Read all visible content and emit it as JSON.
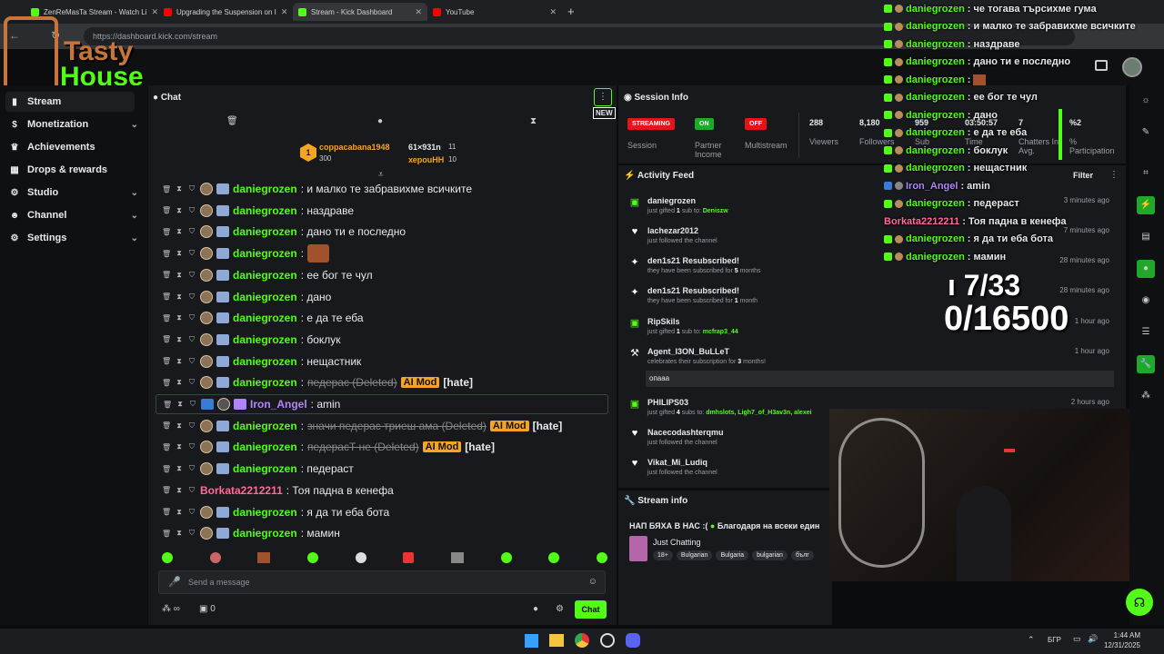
{
  "browser": {
    "tabs": [
      {
        "label": "ZenReMasTa Stream - Watch Li",
        "color": "#53fc18"
      },
      {
        "label": "Upgrading the Suspension on I",
        "color": "#ff0000"
      },
      {
        "label": "Stream - Kick Dashboard",
        "color": "#53fc18"
      },
      {
        "label": "YouTube",
        "color": "#ff0000"
      }
    ],
    "url": "https://dashboard.kick.com/stream"
  },
  "overlay_logo": {
    "line1": "Tasty",
    "line2": "House"
  },
  "nav": {
    "items": [
      {
        "label": "Stream"
      },
      {
        "label": "Monetization"
      },
      {
        "label": "Achievements"
      },
      {
        "label": "Drops & rewards"
      },
      {
        "label": "Studio"
      },
      {
        "label": "Channel"
      },
      {
        "label": "Settings"
      }
    ]
  },
  "chat": {
    "title": "Chat",
    "new_label": "NEW",
    "leaders": [
      {
        "name": "coppacabana1948",
        "value": "300",
        "rank": "1"
      },
      {
        "name": "61×931n",
        "value": "11"
      },
      {
        "name": "хероuHH",
        "value": "10"
      }
    ],
    "messages": [
      {
        "user": "daniegrozen",
        "text": ": и малко те забравихме всичките"
      },
      {
        "user": "daniegrozen",
        "text": ": наздраве"
      },
      {
        "user": "daniegrozen",
        "text": ": дано ти е последно"
      },
      {
        "user": "daniegrozen",
        "text": ":"
      },
      {
        "user": "daniegrozen",
        "text": ": ее бог те чул"
      },
      {
        "user": "daniegrozen",
        "text": ": дано"
      },
      {
        "user": "daniegrozen",
        "text": ": е да те еба"
      },
      {
        "user": "daniegrozen",
        "text": ": боклук"
      },
      {
        "user": "daniegrozen",
        "text": ": нещастник"
      },
      {
        "user": "daniegrozen",
        "text": ":",
        "deleted": "педерас (Deleted)",
        "mod": "AI Mod",
        "tag": "[hate]"
      },
      {
        "user": "Iron_Angel",
        "text": ": amin"
      },
      {
        "user": "daniegrozen",
        "text": ":",
        "deleted": "значи педерас триеш ама (Deleted)",
        "mod": "AI Mod",
        "tag": "[hate]"
      },
      {
        "user": "daniegrozen",
        "text": ":",
        "deleted": "педерасТ не (Deleted)",
        "mod": "AI Mod",
        "tag": "[hate]"
      },
      {
        "user": "daniegrozen",
        "text": ": педераст"
      },
      {
        "user": "Borkata2212211",
        "text": ": Тоя падна в кенефа"
      },
      {
        "user": "daniegrozen",
        "text": ": я да ти еба бота"
      },
      {
        "user": "daniegrozen",
        "text": ": мамин"
      }
    ],
    "input_placeholder": "Send a message",
    "infinity_label": "∞",
    "count_label": "0",
    "send_label": "Chat"
  },
  "session": {
    "title": "Session Info",
    "status": [
      {
        "pill": "STREAMING",
        "label": "Session",
        "color": "#e5131b"
      },
      {
        "pill": "ON",
        "label": "Partner Income",
        "color": "#1fa82a"
      },
      {
        "pill": "OFF",
        "label": "Multistream",
        "color": "#e5131b"
      }
    ],
    "stats": [
      {
        "value": "288",
        "label": "Viewers"
      },
      {
        "value": "8,180",
        "label": "Followers"
      },
      {
        "value": "959",
        "label": "Sub"
      },
      {
        "value": "03:50:57",
        "label": "Time"
      },
      {
        "value": "7",
        "label": "Chatters In Avg."
      },
      {
        "value": "%2",
        "label": "% Participation"
      }
    ]
  },
  "activity": {
    "title": "Activity Feed",
    "filter_label": "Filter",
    "items": [
      {
        "icon": "gift",
        "title": "daniegrozen",
        "sub_pre": "just gifted ",
        "num": "1",
        "sub_mid": " sub to: ",
        "target": "Deniszw",
        "time": "3 minutes ago"
      },
      {
        "icon": "heart",
        "title": "lachezar2012",
        "sub_pre": "just followed the channel",
        "time": "7 minutes ago"
      },
      {
        "icon": "spark",
        "title": "den1s21 Resubscribed!",
        "sub_pre": "they have been subscribed for ",
        "num": "5",
        "sub_mid": " months",
        "time": "28 minutes ago"
      },
      {
        "icon": "spark",
        "title": "den1s21 Resubscribed!",
        "sub_pre": "they have been subscribed for ",
        "num": "1",
        "sub_mid": " month",
        "time": "28 minutes ago"
      },
      {
        "icon": "gift",
        "title": "RipSkils",
        "sub_pre": "just gifted ",
        "num": "1",
        "sub_mid": " sub to: ",
        "target": "mcfrap3_44",
        "time": "1 hour ago"
      },
      {
        "icon": "hammer",
        "title": "Agent_I3ON_BuLLeT",
        "sub_pre": "celebrates their subscription for ",
        "num": "3",
        "sub_mid": " months!",
        "message": "опааа",
        "time": "1 hour ago"
      },
      {
        "icon": "gift",
        "title": "PHILIPS03",
        "sub_pre": "just gifted ",
        "num": "4",
        "sub_mid": " subs to: ",
        "target": "dmhslots, Ligh7_of_H3av3n, alexei",
        "time": "2 hours ago"
      },
      {
        "icon": "heart",
        "title": "Nacecodashterqmu",
        "sub_pre": "just followed the channel",
        "time": ""
      },
      {
        "icon": "heart",
        "title": "Vikat_Mi_Ludiq",
        "sub_pre": "just followed the channel",
        "time": ""
      }
    ]
  },
  "stream_info": {
    "title": "Stream info",
    "stream_title": "НАП БЯХА В НАС :(",
    "stream_title2": "Благодаря на всеки един",
    "category": "Just Chatting",
    "tags": [
      "18+",
      "Bulgarian",
      "Bulgaria",
      "bulgarian",
      "бълг"
    ]
  },
  "overlay_chat": [
    {
      "user": "daniegrozen",
      "text": ": че тогава търсихме гума"
    },
    {
      "user": "daniegrozen",
      "text": ": и малко те забравихме всичките"
    },
    {
      "user": "daniegrozen",
      "text": ": наздраве"
    },
    {
      "user": "daniegrozen",
      "text": ": дано ти е последно"
    },
    {
      "user": "daniegrozen",
      "text": ":"
    },
    {
      "user": "daniegrozen",
      "text": ": ее бог те чул"
    },
    {
      "user": "daniegrozen",
      "text": ": дано"
    },
    {
      "user": "daniegrozen",
      "text": ": е да те еба"
    },
    {
      "user": "daniegrozen",
      "text": ": боклук"
    },
    {
      "user": "daniegrozen",
      "text": ": нещастник"
    },
    {
      "user": "Iron_Angel",
      "text": ": amin"
    },
    {
      "user": "daniegrozen",
      "text": ": педераст"
    },
    {
      "user": "Borkata2212211",
      "text": ": Тоя падна в кенефа"
    },
    {
      "user": "daniegrozen",
      "text": ": я да ти еба бота"
    },
    {
      "user": "daniegrozen",
      "text": ": мамин"
    }
  ],
  "goal": {
    "line1": "ı 7/33",
    "line2": "0/16500"
  },
  "taskbar": {
    "lang": "БГР",
    "time": "1:44 AM",
    "date": "12/31/2025"
  }
}
